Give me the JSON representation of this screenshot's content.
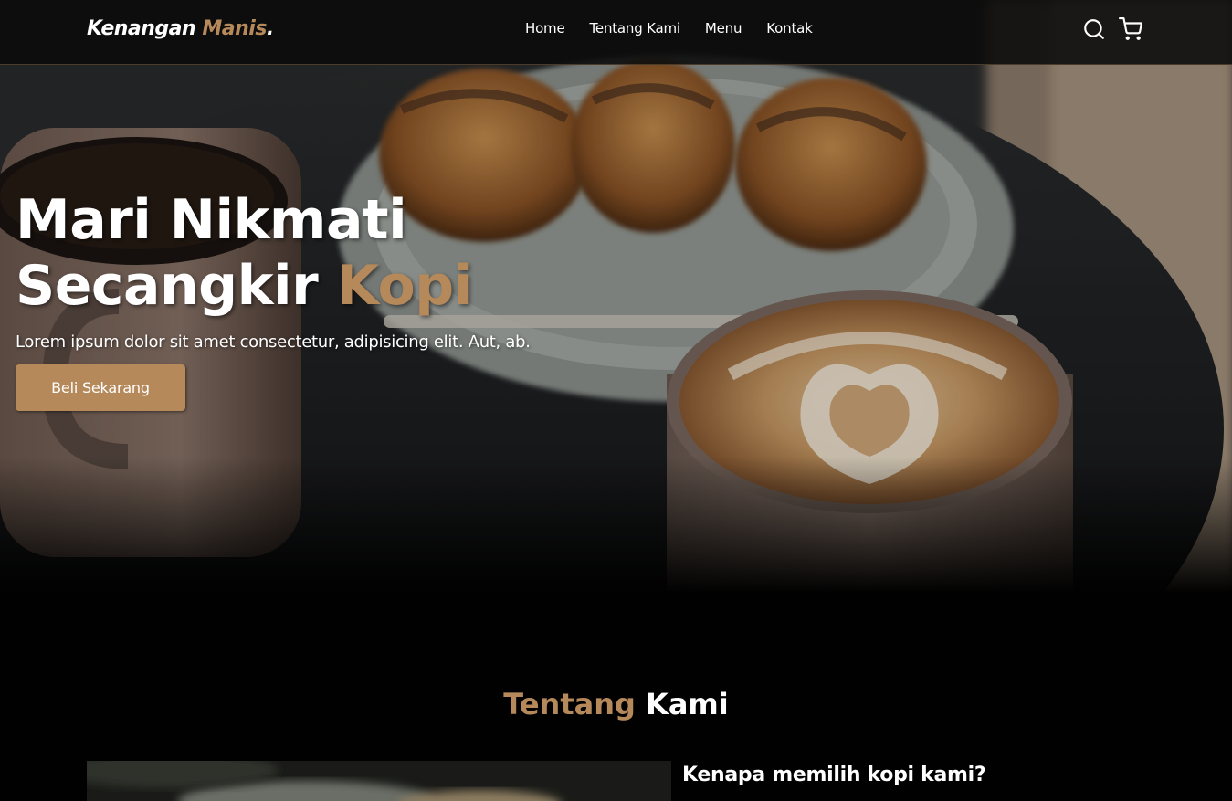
{
  "brand": {
    "name": "Kenangan",
    "accent": "Manis",
    "suffix": "."
  },
  "nav": {
    "links": [
      "Home",
      "Tentang Kami",
      "Menu",
      "Kontak"
    ],
    "icons": [
      "search-icon",
      "shopping-cart-icon"
    ]
  },
  "hero": {
    "title_line1": "Mari Nikmati",
    "title_line2": "Secangkir ",
    "title_accent": "Kopi",
    "text": "Lorem ipsum dolor sit amet consectetur, adipisicing elit. Aut, ab.",
    "cta": "Beli Sekarang"
  },
  "about": {
    "heading_accent": "Tentang",
    "heading_rest": " Kami",
    "subtitle": "Kenapa memilih kopi kami?"
  },
  "colors": {
    "accent": "#b6895b",
    "background": "#010101"
  }
}
